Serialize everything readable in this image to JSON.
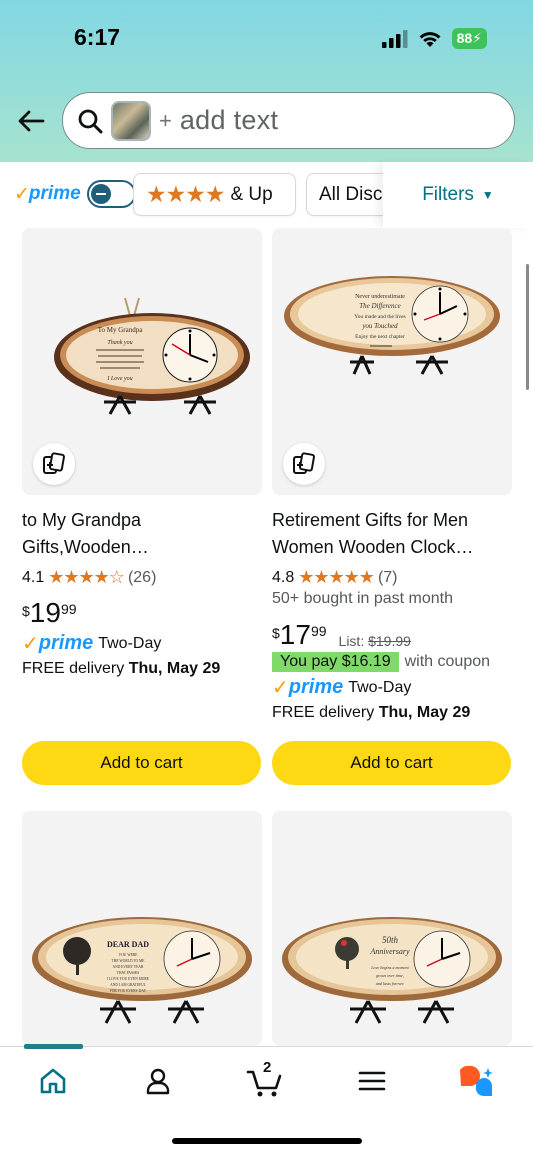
{
  "status_bar": {
    "time": "6:17",
    "battery": "88"
  },
  "search": {
    "plus": "+",
    "placeholder": "add text"
  },
  "filters": {
    "prime_check": "✓",
    "prime_label": "prime",
    "stars_glyphs": "★★★★",
    "stars_label": "& Up",
    "discount_label": "All Discounts",
    "filters_label": "Filters"
  },
  "products": [
    {
      "title_line1": "to My Grandpa",
      "title_line2": "Gifts,Wooden…",
      "rating": "4.1",
      "stars": "★★★★☆",
      "review_count": "(26)",
      "currency": "$",
      "price_whole": "19",
      "price_frac": "99",
      "prime_check": "✓",
      "prime_word": "prime",
      "shipping": "Two-Day",
      "delivery_prefix": "FREE delivery",
      "delivery_date": "Thu, May 29",
      "cart_label": "Add to cart"
    },
    {
      "title_line1": "Retirement Gifts for Men",
      "title_line2": "Women Wooden Clock…",
      "rating": "4.8",
      "stars": "★★★★★",
      "review_count": "(7)",
      "bought": "50+ bought in past month",
      "currency": "$",
      "price_whole": "17",
      "price_frac": "99",
      "list_label": "List:",
      "list_price": "$19.99",
      "coupon_badge": "You pay $16.19",
      "coupon_rest": "with coupon",
      "prime_check": "✓",
      "prime_word": "prime",
      "shipping": "Two-Day",
      "delivery_prefix": "FREE delivery",
      "delivery_date": "Thu, May 29",
      "cart_label": "Add to cart"
    }
  ],
  "clock_texts": {
    "p1_header": "To My Grandpa",
    "p1_thank": "Thank you",
    "p1_love": "I Love you",
    "p2_l1": "Never underestimate",
    "p2_l2": "The Difference",
    "p2_l3": "You made and the lives",
    "p2_l4": "you Touched",
    "p2_l5": "Enjoy the next chapter",
    "p3_title": "DEAR DAD",
    "p3_l1": "YOU WERE",
    "p3_l2": "THE WORLD TO ME",
    "p3_l3": "AND EVERY YEAR",
    "p3_l4": "THAT PASSES",
    "p3_l5": "I LOVE YOU EVEN MORE",
    "p3_l6": "AND I AM GRATEFUL",
    "p3_l7": "FOR YOU EVERY DAY",
    "p4_l1": "50th",
    "p4_l2": "Anniversary",
    "p4_l3": "Love begins a moment",
    "p4_l4": "grows over time,",
    "p4_l5": "and lasts forever."
  },
  "bottom_nav": {
    "cart_count": "2"
  },
  "colors": {
    "accent_teal": "#007185",
    "star_orange": "#de7921",
    "cart_yellow": "#ffd814",
    "prime_blue": "#1a98ff"
  }
}
